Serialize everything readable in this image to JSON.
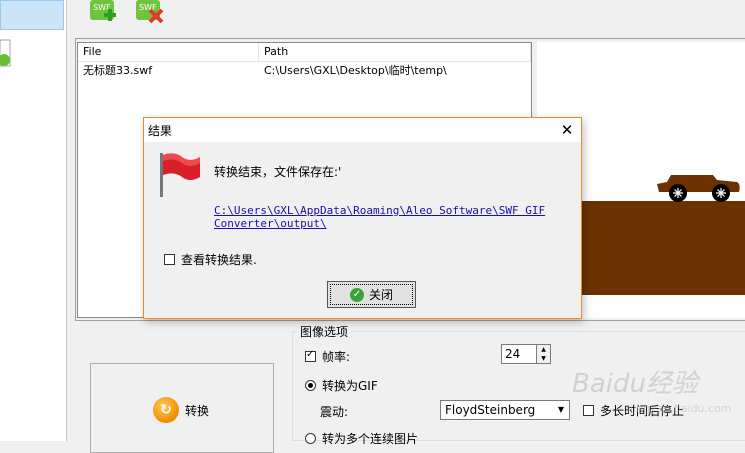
{
  "file_list": {
    "headers": {
      "file": "File",
      "path": "Path"
    },
    "rows": [
      {
        "file": "无标题33.swf",
        "path": "C:\\Users\\GXL\\Desktop\\临时\\temp\\"
      }
    ]
  },
  "toolbar": {
    "add_label": "SWF",
    "remove_label": "SWF"
  },
  "image_options": {
    "group_title": "图像选项",
    "frame_rate_label": "帧率:",
    "frame_rate_value": "24",
    "convert_to_gif_label": "转换为GIF",
    "dither_label": "震动:",
    "dither_value": "FloydSteinberg",
    "stop_after_label": "多长时间后停止",
    "convert_multi_label": "转为多个连续图片"
  },
  "convert_button": {
    "label": "转换"
  },
  "dialog": {
    "title": "结果",
    "message": "转换结束，文件保存在:'",
    "path_link": "C:\\Users\\GXL\\AppData\\Roaming\\Aleo Software\\SWF GIF Converter\\output\\",
    "view_result_label": "查看转换结果.",
    "close_button_label": "关闭"
  },
  "watermark": {
    "text": "Baidu经验",
    "sub": "jingyan.baidu.com"
  },
  "colors": {
    "dialog_border": "#f08a24",
    "ground": "#6b3100",
    "link": "#1a0dab"
  }
}
